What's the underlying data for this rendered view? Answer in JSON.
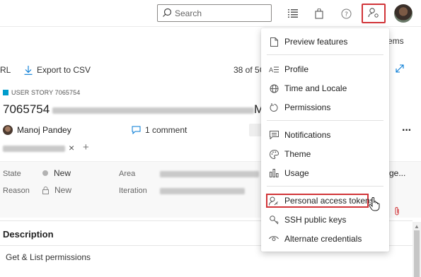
{
  "topbar": {
    "search_placeholder": "Search",
    "icons": [
      "search-icon",
      "list-icon",
      "shopping-bag-icon",
      "help-icon",
      "user-settings-icon",
      "avatar"
    ]
  },
  "toolbar": {
    "rl_text": "RL",
    "export_label": "Export to CSV",
    "count_text": "38 of 5C",
    "right_partial": "ems"
  },
  "work_item": {
    "kind": "USER STORY 7065754",
    "id": "7065754",
    "title_suffix": "M",
    "author": "Manoj Pandey",
    "comments": "1 comment",
    "tag_remove": "×",
    "tag_add": "+",
    "more": "···"
  },
  "fields": {
    "state_label": "State",
    "state_value": "New",
    "reason_label": "Reason",
    "reason_value": "New",
    "area_label": "Area",
    "iteration_label": "Iteration",
    "area_suffix": "ge..."
  },
  "description": {
    "title": "Description",
    "body": "Get & List permissions"
  },
  "menu": {
    "items": [
      {
        "label": "Preview features",
        "icon": "document-icon"
      },
      {
        "label": "Profile",
        "icon": "profile-icon"
      },
      {
        "label": "Time and Locale",
        "icon": "globe-icon"
      },
      {
        "label": "Permissions",
        "icon": "refresh-icon"
      },
      {
        "label": "Notifications",
        "icon": "chat-icon"
      },
      {
        "label": "Theme",
        "icon": "palette-icon"
      },
      {
        "label": "Usage",
        "icon": "bar-chart-icon"
      },
      {
        "label": "Personal access tokens",
        "icon": "user-key-icon"
      },
      {
        "label": "SSH public keys",
        "icon": "key-icon"
      },
      {
        "label": "Alternate credentials",
        "icon": "eye-icon"
      }
    ]
  },
  "colors": {
    "highlight": "#d13438",
    "accent": "#0078d4",
    "story": "#009ccc"
  }
}
